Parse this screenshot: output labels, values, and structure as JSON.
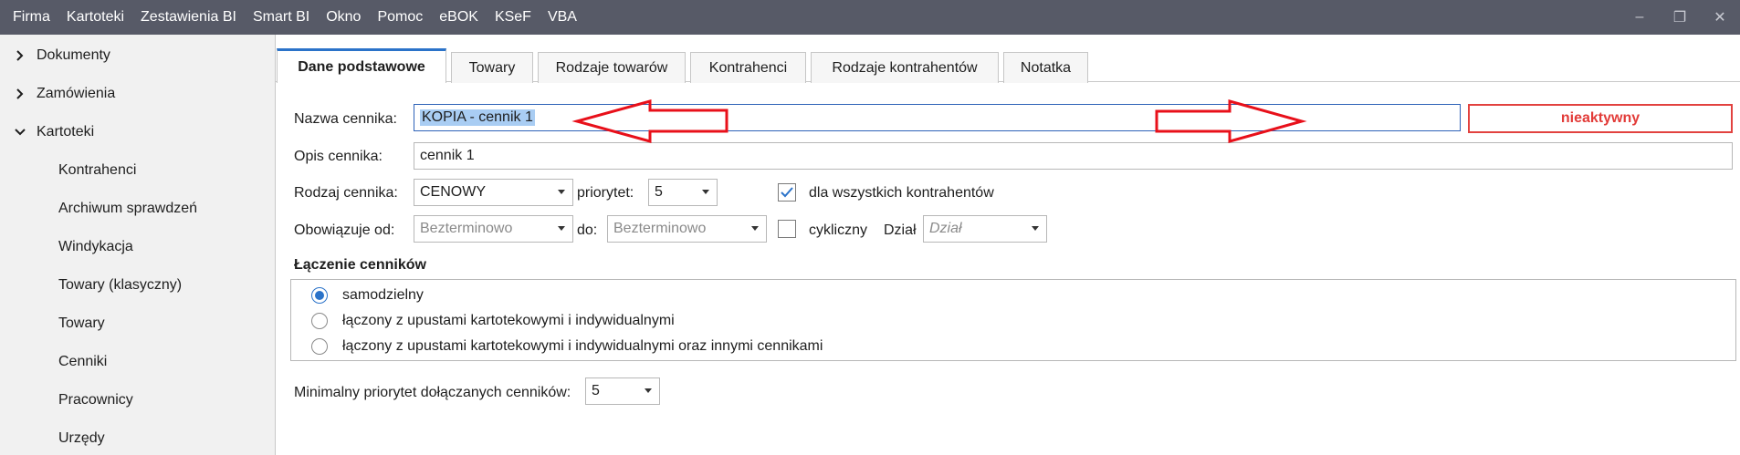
{
  "menu": {
    "items": [
      "Firma",
      "Kartoteki",
      "Zestawienia BI",
      "Smart BI",
      "Okno",
      "Pomoc",
      "eBOK",
      "KSeF",
      "VBA"
    ]
  },
  "window_controls": {
    "minimize": "–",
    "restore": "❐",
    "close": "✕"
  },
  "sidebar": {
    "groups": [
      {
        "label": "Dokumenty",
        "expanded": false
      },
      {
        "label": "Zamówienia",
        "expanded": false
      },
      {
        "label": "Kartoteki",
        "expanded": true
      }
    ],
    "children": [
      "Kontrahenci",
      "Archiwum sprawdzeń",
      "Windykacja",
      "Towary (klasyczny)",
      "Towary",
      "Cenniki",
      "Pracownicy",
      "Urzędy"
    ]
  },
  "tabs": [
    "Dane podstawowe",
    "Towary",
    "Rodzaje towarów",
    "Kontrahenci",
    "Rodzaje kontrahentów",
    "Notatka"
  ],
  "active_tab": "Dane podstawowe",
  "form": {
    "name_label": "Nazwa cennika:",
    "name_value": "KOPIA - cennik 1",
    "status": "nieaktywny",
    "desc_label": "Opis cennika:",
    "desc_value": "cennik 1",
    "type_label": "Rodzaj cennika:",
    "type_value": "CENOWY",
    "priority_label": "priorytet:",
    "priority_value": "5",
    "all_contractors_label": "dla wszystkich kontrahentów",
    "all_contractors_checked": true,
    "valid_from_label": "Obowiązuje od:",
    "valid_from_value": "Bezterminowo",
    "to_label": "do:",
    "to_value": "Bezterminowo",
    "cyclic_label": "cykliczny",
    "cyclic_checked": false,
    "dept_label": "Dział",
    "dept_placeholder": "Dział",
    "merge_title": "Łączenie cenników",
    "merge_options": [
      "samodzielny",
      "łączony z upustami kartotekowymi i indywidualnymi",
      "łączony z upustami kartotekowymi i indywidualnymi oraz innymi cennikami"
    ],
    "merge_selected_index": 0,
    "min_priority_label": "Minimalny priorytet dołączanych cenników:",
    "min_priority_value": "5"
  },
  "colors": {
    "menubar": "#575a67",
    "accent": "#2b73c9",
    "status_red": "#e2423f",
    "annotation_red": "#e8101a",
    "selection": "#a9cdf3"
  },
  "annotations": [
    "left-arrow",
    "right-arrow"
  ]
}
